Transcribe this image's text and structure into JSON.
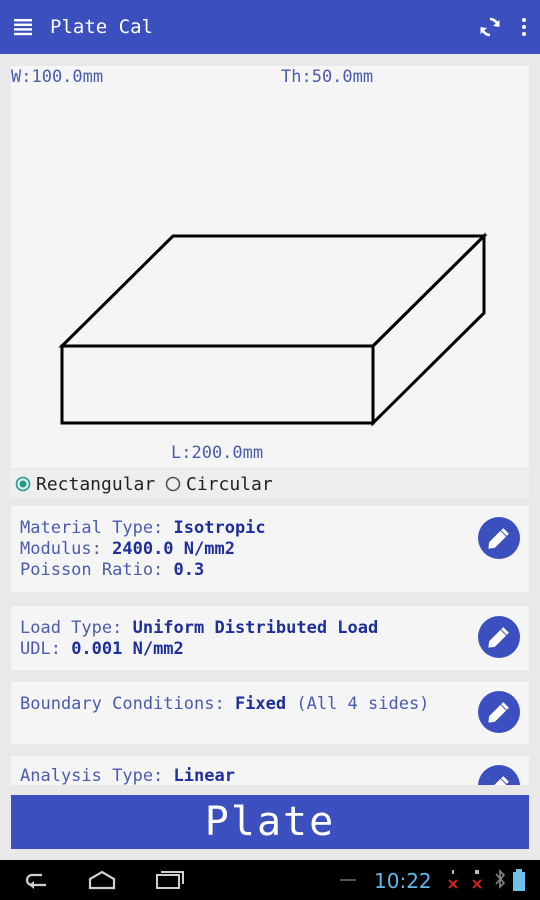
{
  "app": {
    "title": "Plate Cal"
  },
  "dimensions": {
    "width": "W:100.0mm",
    "thickness": "Th:50.0mm",
    "length": "L:200.0mm"
  },
  "shape_options": [
    {
      "label": "Rectangular",
      "selected": true
    },
    {
      "label": "Circular",
      "selected": false
    }
  ],
  "material": {
    "type_label": "Material Type: ",
    "type_value": "Isotropic",
    "modulus_label": "Modulus: ",
    "modulus_value": "2400.0 N/mm2",
    "poisson_label": "Poisson Ratio: ",
    "poisson_value": "0.3"
  },
  "load": {
    "type_label": "Load Type: ",
    "type_value": "Uniform Distributed Load",
    "udl_label": "UDL: ",
    "udl_value": "0.001 N/mm2"
  },
  "boundary": {
    "label": "Boundary Conditions: ",
    "value": "Fixed",
    "note": " (All 4 sides)"
  },
  "analysis": {
    "label": "Analysis Type: ",
    "value": "Linear"
  },
  "action_button": {
    "label": "Plate"
  },
  "status_bar": {
    "time": "10:22"
  },
  "colors": {
    "primary": "#3b4fbf",
    "radio_accent": "#1a9c8a",
    "clock": "#5fb8e8"
  },
  "icons": [
    "menu-icon",
    "refresh-icon",
    "more-vert-icon",
    "pencil-icon",
    "back-icon",
    "home-icon",
    "recent-apps-icon"
  ]
}
